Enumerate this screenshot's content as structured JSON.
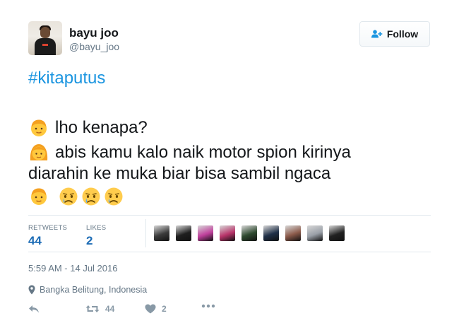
{
  "user": {
    "name": "bayu joo",
    "handle": "@bayu_joo"
  },
  "follow": {
    "label": "Follow",
    "icon": "add-user-icon"
  },
  "tweet": {
    "hashtag": "#kitaputus",
    "lines": [
      "lho kenapa?",
      "abis kamu kalo naik motor spion kirinya",
      "diarahin ke muka biar bisa sambil ngaca"
    ],
    "emojis": {
      "line1": "boy-emoji",
      "line2": "girl-emoji",
      "line4": [
        "boy-emoji",
        "crying-face-emoji",
        "crying-face-emoji",
        "crying-face-emoji"
      ]
    }
  },
  "stats": {
    "retweets_label": "RETWEETS",
    "retweets_value": "44",
    "likes_label": "LIKES",
    "likes_value": "2",
    "liker_avatar_colors": [
      "#3b3b3b",
      "#1f1f1f",
      "#c0409c",
      "#b8346a",
      "#2f4a30",
      "#203048",
      "#8b5a4a",
      "#9aa0a8",
      "#222222"
    ]
  },
  "timestamp": "5:59 AM - 14 Jul 2016",
  "location": {
    "icon": "location-pin-icon",
    "label": "Bangka Belitung, Indonesia"
  },
  "actions": {
    "reply_icon": "reply-icon",
    "retweet_icon": "retweet-icon",
    "retweet_count": "44",
    "like_icon": "heart-icon",
    "like_count": "2",
    "more_icon": "more-icon"
  },
  "colors": {
    "link": "#1b95e0",
    "stat_value": "#1b6bb5",
    "muted": "#657786",
    "action": "#8899a6",
    "border": "#e1e8ed"
  }
}
